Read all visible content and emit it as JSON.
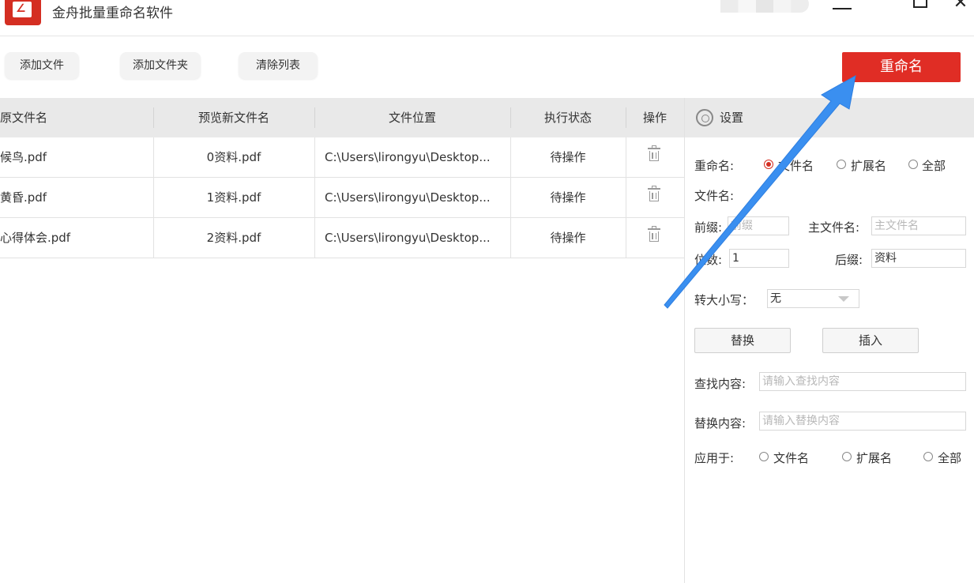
{
  "window": {
    "title": "金舟批量重命名软件"
  },
  "toolbar": {
    "add_file": "添加文件",
    "add_folder": "添加文件夹",
    "clear_list": "清除列表",
    "rename": "重命名"
  },
  "table": {
    "headers": [
      "原文件名",
      "预览新文件名",
      "文件位置",
      "执行状态",
      "操作"
    ],
    "rows": [
      {
        "original": "候鸟.pdf",
        "preview": "0资料.pdf",
        "location": "C:\\Users\\lirongyu\\Desktop...",
        "status": "待操作"
      },
      {
        "original": "黄昏.pdf",
        "preview": "1资料.pdf",
        "location": "C:\\Users\\lirongyu\\Desktop...",
        "status": "待操作"
      },
      {
        "original": "心得体会.pdf",
        "preview": "2资料.pdf",
        "location": "C:\\Users\\lirongyu\\Desktop...",
        "status": "待操作"
      }
    ]
  },
  "settings": {
    "title": "设置",
    "rename_label": "重命名:",
    "rename_options": [
      "文件名",
      "扩展名",
      "全部"
    ],
    "rename_selected": "文件名",
    "filename_label": "文件名:",
    "prefix_label": "前缀:",
    "prefix_placeholder": "前缀",
    "main_label": "主文件名:",
    "main_placeholder": "主文件名",
    "digits_label": "位数:",
    "digits_value": "1",
    "suffix_label": "后缀:",
    "suffix_value": "资料",
    "case_label": "转大小写：",
    "case_value": "无",
    "replace_button": "替换",
    "insert_button": "插入",
    "find_label": "查找内容:",
    "find_placeholder": "请输入查找内容",
    "replace_label": "替换内容:",
    "replace_placeholder": "请输入替换内容",
    "apply_label": "应用于:",
    "apply_options": [
      "文件名",
      "扩展名",
      "全部"
    ]
  },
  "colors": {
    "accent": "#e02d25",
    "annotation_arrow": "#3a8ff0"
  }
}
